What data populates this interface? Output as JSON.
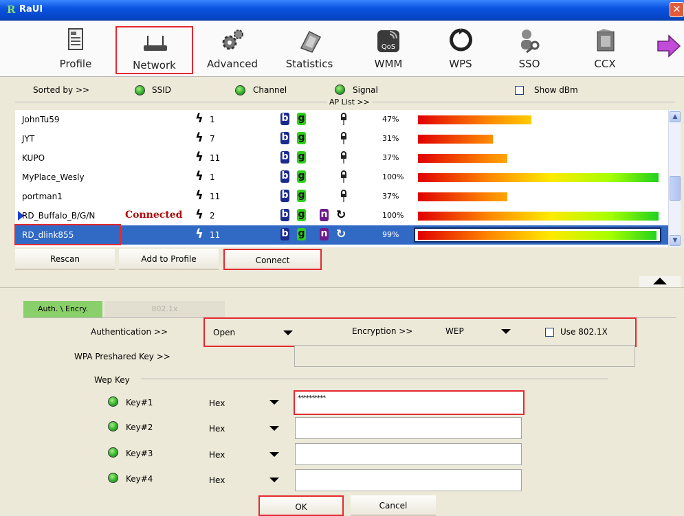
{
  "window": {
    "title": "RaUI",
    "logo_letter": "R",
    "close_glyph": "✕"
  },
  "toolbar": {
    "items": [
      {
        "label": "Profile",
        "icon": "profile-icon"
      },
      {
        "label": "Network",
        "icon": "network-router-icon",
        "selected": true
      },
      {
        "label": "Advanced",
        "icon": "gears-icon"
      },
      {
        "label": "Statistics",
        "icon": "calculator-icon"
      },
      {
        "label": "WMM",
        "icon": "qos-icon"
      },
      {
        "label": "WPS",
        "icon": "wps-icon"
      },
      {
        "label": "SSO",
        "icon": "sso-key-icon"
      },
      {
        "label": "CCX",
        "icon": "ccx-icon"
      }
    ],
    "next_icon": "next-arrow-icon"
  },
  "sort": {
    "label": "Sorted by >>",
    "options": [
      "SSID",
      "Channel",
      "Signal"
    ],
    "show_dbm": "Show dBm",
    "ap_list_label": "AP List >>"
  },
  "ap_list": [
    {
      "ssid": "JohnTu59",
      "status": "",
      "channel": "1",
      "modes": [
        "b",
        "g"
      ],
      "security": "lock",
      "signal_pct": 47,
      "signal_text": "47%"
    },
    {
      "ssid": "JYT",
      "status": "",
      "channel": "7",
      "modes": [
        "b",
        "g"
      ],
      "security": "lock",
      "signal_pct": 31,
      "signal_text": "31%"
    },
    {
      "ssid": "KUPO",
      "status": "",
      "channel": "11",
      "modes": [
        "b",
        "g"
      ],
      "security": "lock",
      "signal_pct": 37,
      "signal_text": "37%"
    },
    {
      "ssid": "MyPlace_Wesly",
      "status": "",
      "channel": "1",
      "modes": [
        "b",
        "g"
      ],
      "security": "lock",
      "signal_pct": 100,
      "signal_text": "100%"
    },
    {
      "ssid": "portman1",
      "status": "",
      "channel": "11",
      "modes": [
        "b",
        "g"
      ],
      "security": "lock",
      "signal_pct": 37,
      "signal_text": "37%"
    },
    {
      "ssid": "RD_Buffalo_B/G/N",
      "status": "Connected",
      "channel": "2",
      "modes": [
        "b",
        "g",
        "n"
      ],
      "security": "wps",
      "signal_pct": 100,
      "signal_text": "100%"
    },
    {
      "ssid": "RD_dlink855",
      "status": "",
      "channel": "11",
      "modes": [
        "b",
        "g",
        "n"
      ],
      "security": "wps",
      "signal_pct": 99,
      "signal_text": "99%",
      "selected": true
    }
  ],
  "buttons": {
    "rescan": "Rescan",
    "add_to_profile": "Add to Profile",
    "connect": "Connect",
    "ok": "OK",
    "cancel": "Cancel"
  },
  "tabs": {
    "auth": "Auth. \\ Encry.",
    "dot1x": "802.1x"
  },
  "auth": {
    "auth_label": "Authentication >>",
    "auth_value": "Open",
    "enc_label": "Encryption >>",
    "enc_value": "WEP",
    "use8021x": "Use 802.1X",
    "wpa_label": "WPA Preshared Key >>"
  },
  "wep": {
    "group_label": "Wep Key",
    "keys": [
      {
        "label": "Key#1",
        "format": "Hex",
        "value": "**********"
      },
      {
        "label": "Key#2",
        "format": "Hex",
        "value": ""
      },
      {
        "label": "Key#3",
        "format": "Hex",
        "value": ""
      },
      {
        "label": "Key#4",
        "format": "Hex",
        "value": ""
      }
    ]
  },
  "colors": {
    "highlight": "#e5292f",
    "selection": "#316ac5",
    "tab_active": "#8ad06a",
    "titlebar": "#0a53e0"
  }
}
